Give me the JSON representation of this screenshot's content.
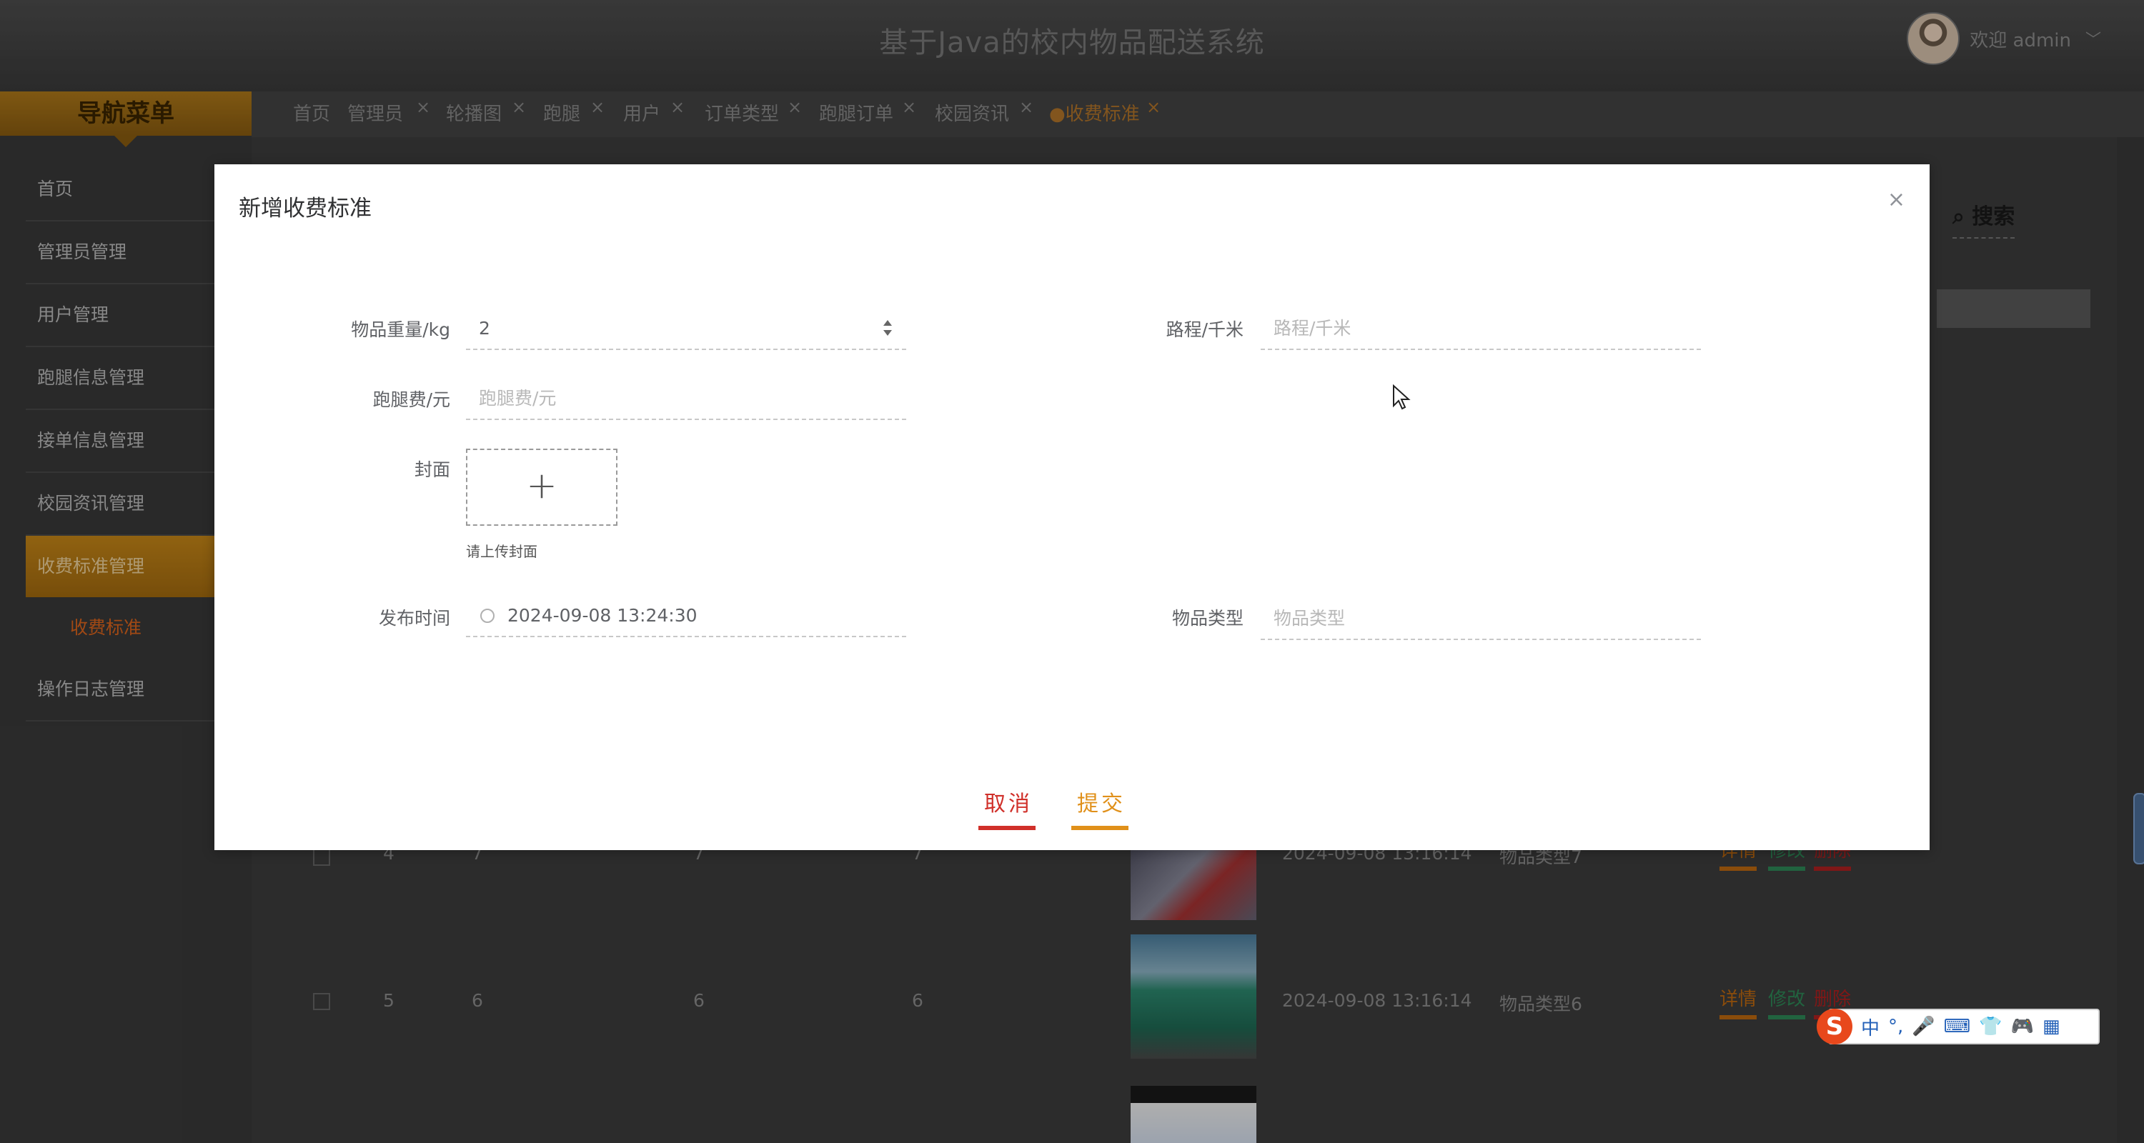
{
  "header": {
    "title": "基于Java的校内物品配送系统",
    "welcome": "欢迎 admin",
    "chevron": "﹀"
  },
  "sidebar": {
    "heading": "导航菜单",
    "items": [
      {
        "label": "首页"
      },
      {
        "label": "管理员管理"
      },
      {
        "label": "用户管理"
      },
      {
        "label": "跑腿信息管理"
      },
      {
        "label": "接单信息管理"
      },
      {
        "label": "校园资讯管理"
      },
      {
        "label": "收费标准管理"
      },
      {
        "label": "收费标准"
      },
      {
        "label": "操作日志管理"
      }
    ]
  },
  "tabs": [
    {
      "label": "首页"
    },
    {
      "label": "管理员"
    },
    {
      "label": "轮播图"
    },
    {
      "label": "跑腿"
    },
    {
      "label": "用户"
    },
    {
      "label": "订单类型"
    },
    {
      "label": "跑腿订单"
    },
    {
      "label": "校园资讯"
    },
    {
      "label": "●收费标准"
    }
  ],
  "tab_close_glyph": "×",
  "search": {
    "label": "搜索"
  },
  "table": {
    "rows": [
      {
        "no": "4",
        "c1": "7",
        "c2": "7",
        "c3": "7",
        "time": "2024-09-08 13:16:14",
        "type": "物品类型7"
      },
      {
        "no": "5",
        "c1": "6",
        "c2": "6",
        "c3": "6",
        "time": "2024-09-08 13:16:14",
        "type": "物品类型6"
      }
    ],
    "actions": {
      "detail": "详情",
      "edit": "修改",
      "delete": "删除"
    }
  },
  "dialog": {
    "title": "新增收费标准",
    "close": "×",
    "fields": {
      "weight": {
        "label": "物品重量/kg",
        "value": "2"
      },
      "distance": {
        "label": "路程/千米",
        "placeholder": "路程/千米"
      },
      "fee": {
        "label": "跑腿费/元",
        "placeholder": "跑腿费/元"
      },
      "cover": {
        "label": "封面",
        "tip": "请上传封面",
        "plus": "+"
      },
      "publish_time": {
        "label": "发布时间",
        "value": "2024-09-08 13:24:30"
      },
      "item_type": {
        "label": "物品类型",
        "placeholder": "物品类型"
      }
    },
    "buttons": {
      "cancel": "取消",
      "submit": "提交"
    }
  },
  "ime": {
    "logo": "S",
    "items": [
      "中",
      "°,",
      "🎤",
      "⌨",
      "👕",
      "🎮",
      "▦"
    ]
  },
  "colors": {
    "accent_orange": "#c88818",
    "cancel_red": "#d0302a",
    "submit_orange": "#e0901a",
    "active_sub": "#e0661c"
  }
}
